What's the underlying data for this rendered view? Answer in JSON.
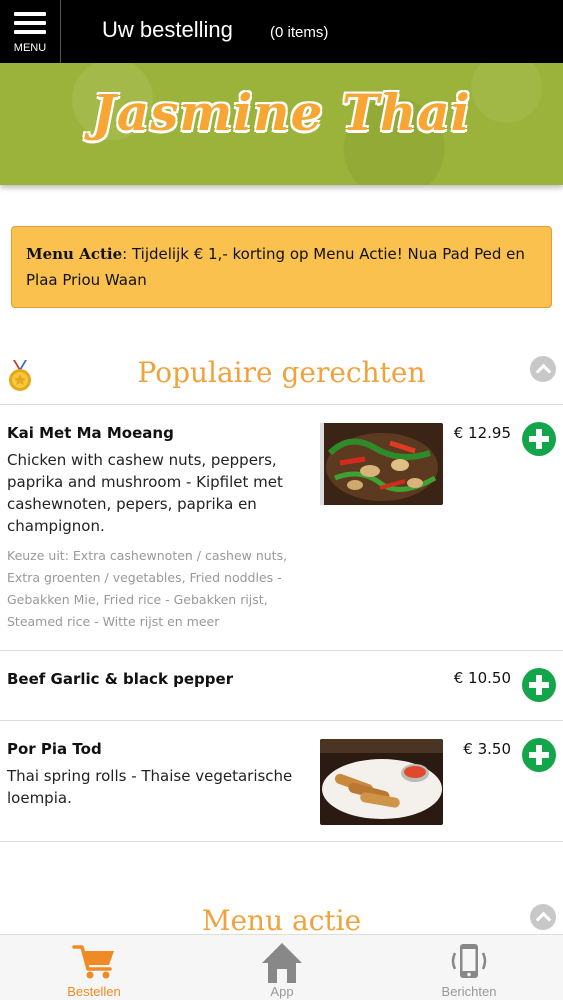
{
  "header": {
    "menu_label": "MENU",
    "title": "Uw bestelling",
    "item_count": "(0 items)"
  },
  "banner": {
    "logo_text": "Jasmine Thai"
  },
  "promo": {
    "label": "Menu Actie",
    "text": ": Tijdelijk € 1,- korting op Menu Actie! Nua Pad Ped en Plaa Priou Waan"
  },
  "sections": [
    {
      "title": "Populaire gerechten",
      "icon": "medal-icon"
    },
    {
      "title": "Menu actie"
    }
  ],
  "items": [
    {
      "name": "Kai Met Ma Moeang",
      "description": "Chicken with cashew nuts, peppers, paprika and mushroom - Kipfilet met cashewnoten, pepers, paprika en champignon.",
      "choices": "Keuze uit: Extra cashewnoten / cashew nuts, Extra groenten / vegetables, Fried noddles - Gebakken Mie, Fried rice - Gebakken rijst, Steamed rice - Witte rijst en meer",
      "price": "€ 12.95"
    },
    {
      "name": "Beef Garlic & black pepper",
      "price": "€ 10.50"
    },
    {
      "name": "Por Pia Tod",
      "description": "Thai spring rolls - Thaise vegetarische loempia.",
      "price": "€ 3.50"
    }
  ],
  "tabs": [
    {
      "label": "Bestellen",
      "icon": "cart-icon",
      "active": true
    },
    {
      "label": "App",
      "icon": "home-icon",
      "active": false
    },
    {
      "label": "Berichten",
      "icon": "phone-icon",
      "active": false
    }
  ],
  "colors": {
    "accent_orange": "#f2a23c",
    "banner_green": "#9bb33a",
    "promo_yellow": "#fbc14f",
    "add_green": "#13a54a"
  }
}
